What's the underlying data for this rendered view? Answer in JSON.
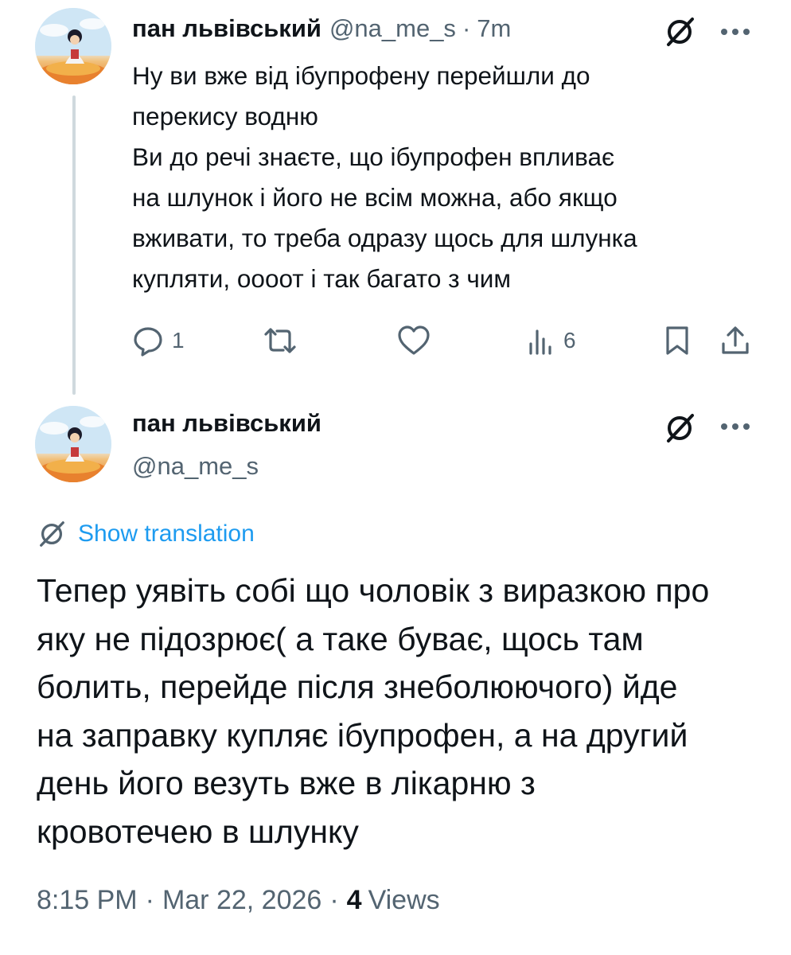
{
  "reply_tweet": {
    "display_name": "пан львівський",
    "handle": "@na_me_s",
    "separator": "·",
    "time": "7m",
    "more_icon": "ellipsis-icon",
    "grok_icon": "slash-circle-icon",
    "text_lines": [
      "Ну ви вже від ібупрофену перейшли до",
      "перекису водню",
      "Ви до речі знаєте, що ібупрофен впливає",
      "на шлунок і його не всім можна, або якщо",
      "вживати, то треба одразу щось для шлунка",
      "купляти, оооот і так багато з чим"
    ],
    "actions": {
      "reply_count": "1",
      "retweet_count": "",
      "like_count": "",
      "views_count": "6"
    }
  },
  "main_tweet": {
    "display_name": "пан львівський",
    "handle": "@na_me_s",
    "show_translation": "Show translation",
    "text_lines": [
      "Тепер уявіть собі що чоловік з виразкою про",
      "яку не підозрює( а таке буває, щось там",
      "болить, перейде після знеболюючого) йде",
      "на заправку купляє ібупрофен, а на другий",
      "день його везуть вже в лікарню з",
      "кровотечею в шлунку"
    ],
    "time": "8:15 PM",
    "date": "Mar 22, 2026",
    "views_count": "4",
    "views_label": "Views",
    "separator": "·"
  },
  "colors": {
    "text_primary": "#0f1419",
    "text_secondary": "#536471",
    "link_blue": "#1d9bf0",
    "thread_line": "#cfd9de"
  }
}
